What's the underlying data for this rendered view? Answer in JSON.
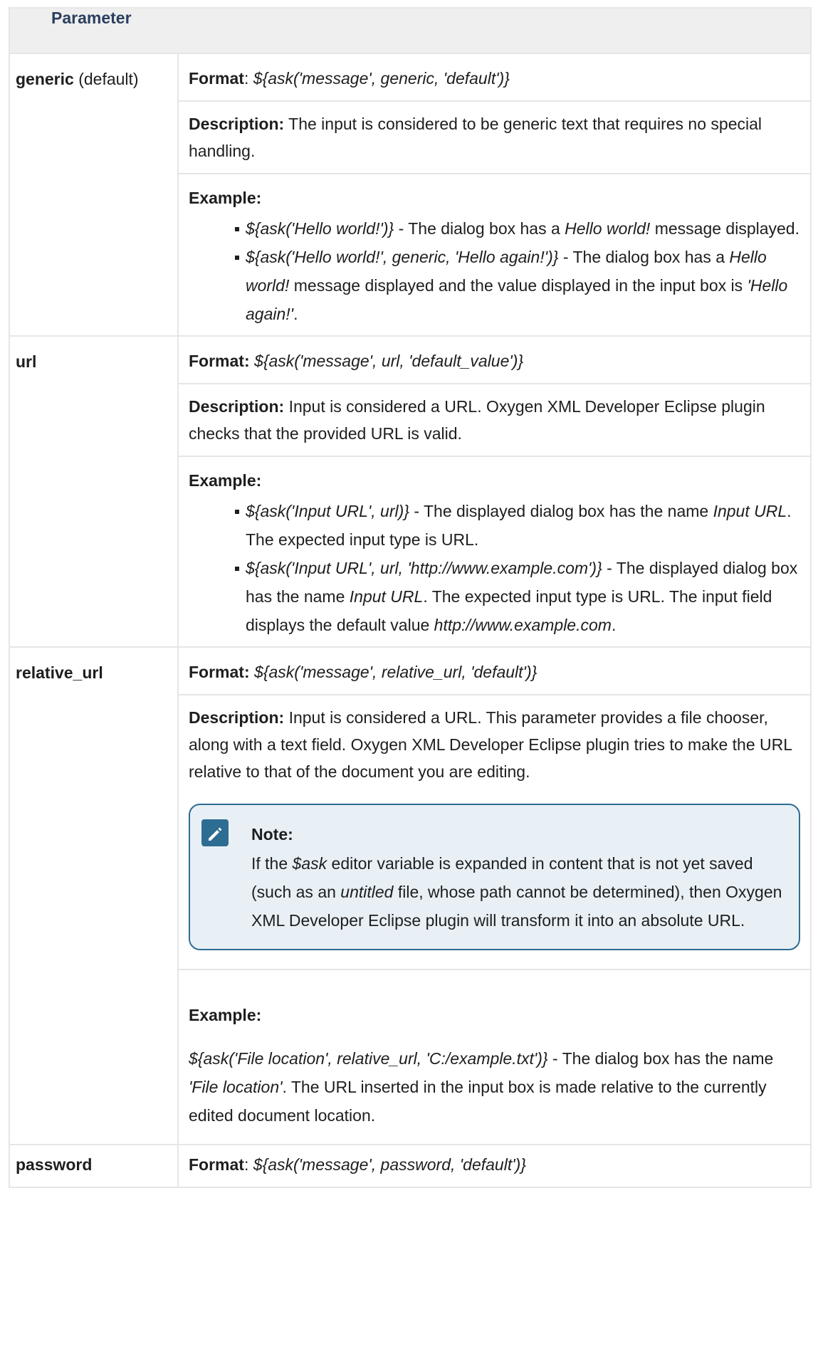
{
  "table": {
    "header": "Parameter",
    "rows": {
      "generic": {
        "name": "generic",
        "name_suffix": " (default)",
        "format_label": "Format",
        "format_sep": ": ",
        "format_value": "${ask('message', generic, 'default')}",
        "desc_label": "Description:",
        "desc_text": " The input is considered to be generic text that requires no special handling.",
        "example_label": "Example:",
        "ex1_code": "${ask('Hello world!')}",
        "ex1_t1": " - The dialog box has a ",
        "ex1_i1": "Hello world!",
        "ex1_t2": " message displayed.",
        "ex2_code": "${ask('Hello world!', generic, 'Hello again!')}",
        "ex2_t1": " - The dialog box has a ",
        "ex2_i1": "Hello world!",
        "ex2_t2": " message displayed and the value displayed in the input box is ",
        "ex2_i2": "'Hello again!'",
        "ex2_t3": "."
      },
      "url": {
        "name": "url",
        "format_label": "Format:",
        "format_value": "${ask('message', url, 'default_value')}",
        "desc_label": "Description:",
        "desc_text": " Input is considered a URL. Oxygen XML Developer Eclipse plugin checks that the provided URL is valid.",
        "example_label": "Example:",
        "ex1_code": "${ask('Input URL', url)}",
        "ex1_t1": " - The displayed dialog box has the name ",
        "ex1_i1": "Input URL",
        "ex1_t2": ". The expected input type is URL.",
        "ex2_code": "${ask('Input URL', url, 'http://www.example.com')}",
        "ex2_t1": " - The displayed dialog box has the name ",
        "ex2_i1": "Input URL",
        "ex2_t2": ". The expected input type is URL. The input field displays the default value ",
        "ex2_i2": "http://www.example.com",
        "ex2_t3": "."
      },
      "relative_url": {
        "name": "relative_url",
        "format_label": "Format:",
        "format_value": "${ask('message', relative_url, 'default')}",
        "desc_label": "Description:",
        "desc_text": " Input is considered a URL. This parameter provides a file chooser, along with a text field. Oxygen XML Developer Eclipse plugin tries to make the URL relative to that of the document you are editing.",
        "note_title": "Note:",
        "note_t1": "If the ",
        "note_i1": "$ask",
        "note_t2": " editor variable is expanded in content that is not yet saved (such as an ",
        "note_i2": "untitled",
        "note_t3": " file, whose path cannot be determined), then Oxygen XML Developer Eclipse plugin will transform it into an absolute URL.",
        "example_label": "Example:",
        "ex_code": "${ask('File location', relative_url, 'C:/example.txt')}",
        "ex_t1": " - The dialog box has the name ",
        "ex_i1": "'File location'",
        "ex_t2": ". The URL inserted in the input box is made relative to the currently edited document location."
      },
      "password": {
        "name": "password",
        "format_label": "Format",
        "format_sep": ": ",
        "format_value": "${ask('message', password, 'default')}"
      }
    }
  },
  "colors": {
    "header_bg": "#efefef",
    "header_text": "#2a3f5f",
    "border": "#e6e6e6",
    "note_border": "#2e6d92",
    "note_bg": "#e8f0f6"
  },
  "icons": {
    "note": "pencil-note-icon"
  }
}
